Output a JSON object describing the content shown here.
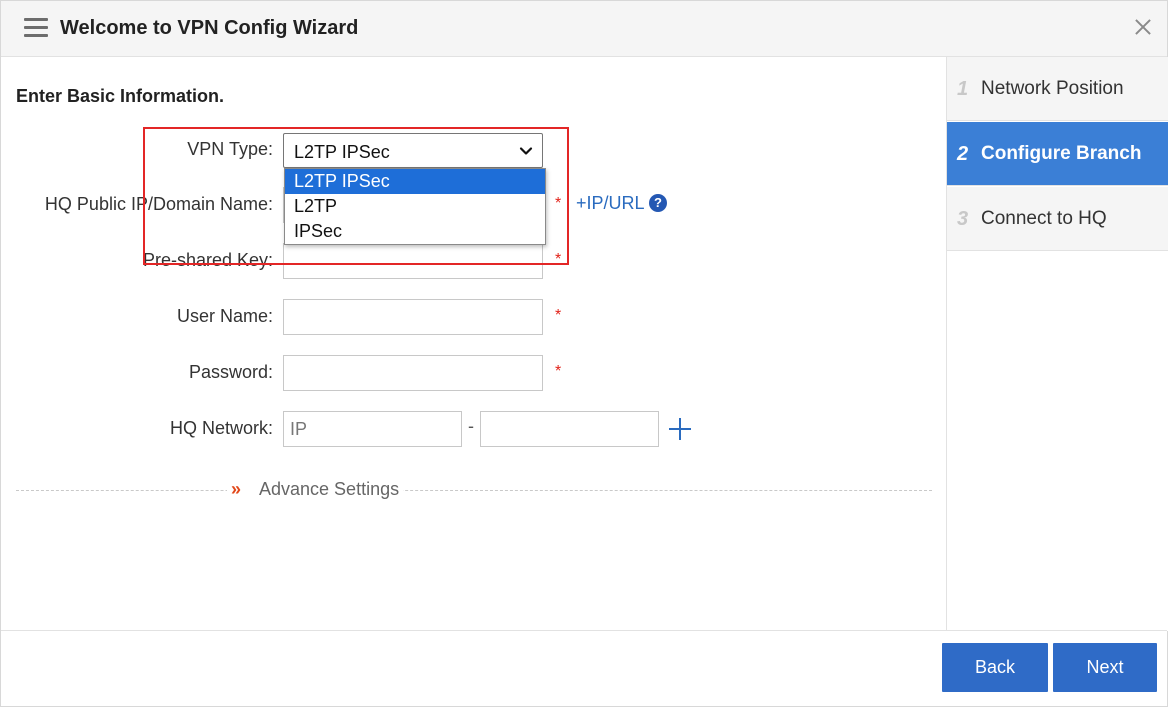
{
  "header": {
    "title": "Welcome to VPN Config Wizard",
    "menu_icon": "hamburger-menu-icon",
    "close_icon": "close-icon"
  },
  "form": {
    "section_title": "Enter Basic Information.",
    "vpn_type": {
      "label": "VPN Type:",
      "selected": "L2TP IPSec",
      "options": [
        "L2TP IPSec",
        "L2TP",
        "IPSec"
      ],
      "highlighted_option": "L2TP IPSec"
    },
    "hq_public_ip": {
      "label": "HQ Public IP/Domain Name:",
      "value": "",
      "required_mark": "*",
      "link": "+IP/URL",
      "help_icon": "?"
    },
    "pre_shared_key": {
      "label": "Pre-shared Key:",
      "value": "",
      "required_mark": "*"
    },
    "user_name": {
      "label": "User Name:",
      "value": "",
      "required_mark": "*"
    },
    "password": {
      "label": "Password:",
      "value": "",
      "required_mark": "*"
    },
    "hq_network": {
      "label": "HQ Network:",
      "ip_placeholder": "IP",
      "ip_value": "",
      "separator": "-",
      "mask_value": "",
      "add_icon": "plus-icon"
    },
    "advance_settings": {
      "icon": "»",
      "label": "Advance Settings"
    }
  },
  "steps": [
    {
      "num": "1",
      "label": "Network Position",
      "active": false
    },
    {
      "num": "2",
      "label": "Configure Branch",
      "active": true
    },
    {
      "num": "3",
      "label": "Connect to HQ",
      "active": false
    }
  ],
  "footer": {
    "back_label": "Back",
    "next_label": "Next"
  },
  "colors": {
    "accent": "#2f6bc7",
    "active_step": "#3b7fd6",
    "required": "#e2231a",
    "highlight_box": "#e32626",
    "link": "#2a6bbf"
  }
}
